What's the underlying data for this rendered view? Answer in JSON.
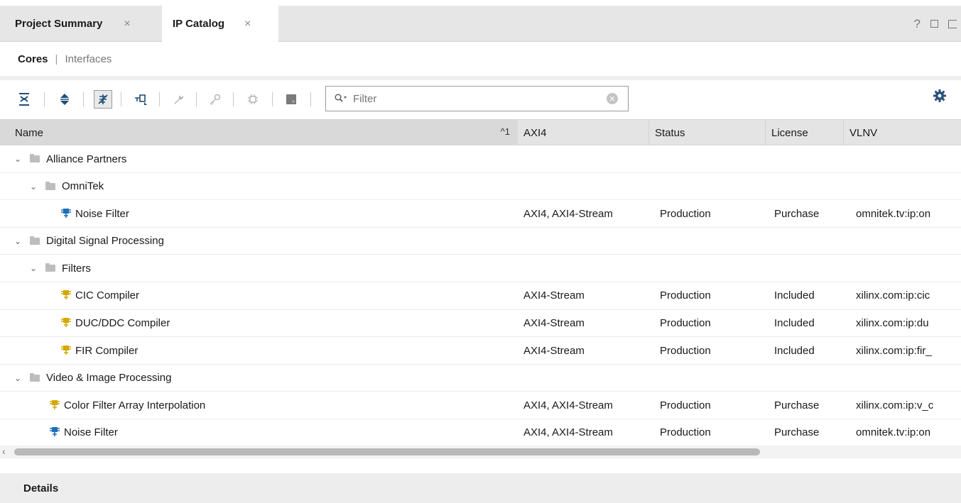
{
  "tabs": [
    {
      "label": "Project Summary",
      "close": "×"
    },
    {
      "label": "IP Catalog",
      "close": "×"
    }
  ],
  "window_controls": {
    "help": "?"
  },
  "subnav": {
    "cores": "Cores",
    "separator": "|",
    "interfaces": "Interfaces"
  },
  "toolbar": {
    "icons": [
      "collapse-all-icon",
      "expand-all-icon",
      "filter-toggle-icon",
      "hierarchy-icon",
      "wrench-icon",
      "key-icon",
      "chip-icon",
      "block-icon",
      "settings-gear-icon"
    ],
    "filter_placeholder": "Filter"
  },
  "table": {
    "columns": {
      "name": "Name",
      "sort": "^1",
      "axi": "AXI4",
      "status": "Status",
      "license": "License",
      "vlnv": "VLNV"
    },
    "rows": [
      {
        "type": "folder",
        "level": 0,
        "name": "Alliance Partners",
        "axi": "",
        "status": "",
        "license": "",
        "vlnv": ""
      },
      {
        "type": "folder",
        "level": 1,
        "name": "OmniTek",
        "axi": "",
        "status": "",
        "license": "",
        "vlnv": ""
      },
      {
        "type": "ip",
        "level": 2,
        "icon": "blue",
        "name": "Noise Filter",
        "axi": "AXI4, AXI4-Stream",
        "status": "Production",
        "license": "Purchase",
        "vlnv": "omnitek.tv:ip:on"
      },
      {
        "type": "folder",
        "level": 0,
        "name": "Digital Signal Processing",
        "axi": "",
        "status": "",
        "license": "",
        "vlnv": ""
      },
      {
        "type": "folder",
        "level": 1,
        "name": "Filters",
        "axi": "",
        "status": "",
        "license": "",
        "vlnv": ""
      },
      {
        "type": "ip",
        "level": 2,
        "icon": "yellow",
        "name": "CIC Compiler",
        "axi": "AXI4-Stream",
        "status": "Production",
        "license": "Included",
        "vlnv": "xilinx.com:ip:cic"
      },
      {
        "type": "ip",
        "level": 2,
        "icon": "yellow",
        "name": "DUC/DDC Compiler",
        "axi": "AXI4-Stream",
        "status": "Production",
        "license": "Included",
        "vlnv": "xilinx.com:ip:du"
      },
      {
        "type": "ip",
        "level": 2,
        "icon": "yellow",
        "name": "FIR Compiler",
        "axi": "AXI4-Stream",
        "status": "Production",
        "license": "Included",
        "vlnv": "xilinx.com:ip:fir_"
      },
      {
        "type": "folder",
        "level": 0,
        "name": "Video & Image Processing",
        "axi": "",
        "status": "",
        "license": "",
        "vlnv": ""
      },
      {
        "type": "ip",
        "level": 1,
        "icon": "yellow",
        "name": "Color Filter Array Interpolation",
        "axi": "AXI4, AXI4-Stream",
        "status": "Production",
        "license": "Purchase",
        "vlnv": "xilinx.com:ip:v_c"
      },
      {
        "type": "ip",
        "level": 1,
        "icon": "blue",
        "name": "Noise Filter",
        "axi": "AXI4, AXI4-Stream",
        "status": "Production",
        "license": "Purchase",
        "vlnv": "omnitek.tv:ip:on"
      }
    ]
  },
  "details": {
    "label": "Details"
  },
  "colors": {
    "ip_blue": "#1e6fb8",
    "ip_yellow": "#d4a800",
    "accent": "#1f4e79"
  }
}
